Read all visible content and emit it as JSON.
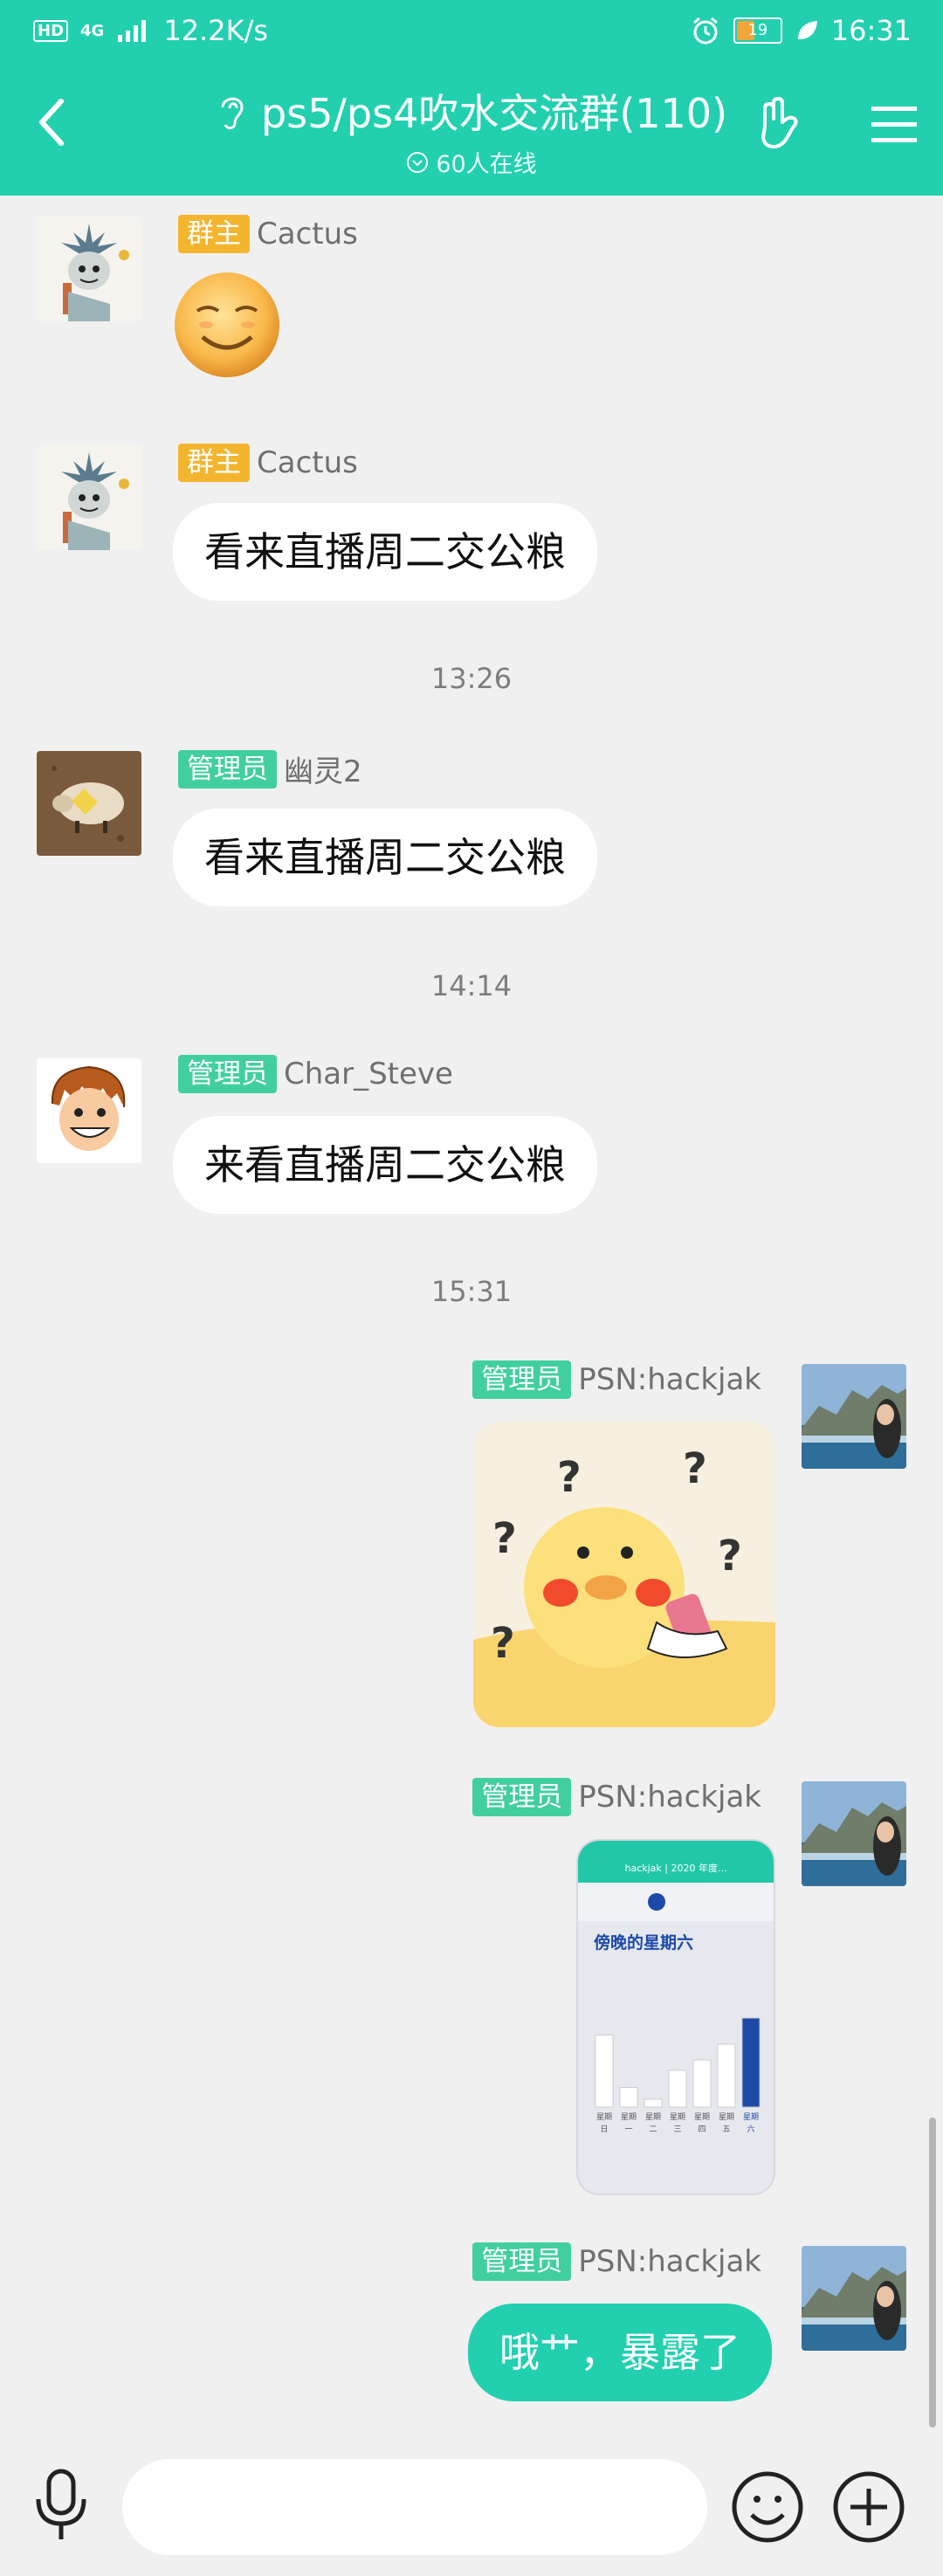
{
  "status_bar": {
    "network_type": "HD",
    "signal": "4G",
    "speed": "12.2K/s",
    "battery": "19",
    "time": "16:31"
  },
  "header": {
    "title": "ps5/ps4吹水交流群(110)",
    "online": "60人在线"
  },
  "messages": [
    {
      "role": "群主",
      "name": "Cactus"
    },
    {
      "role": "群主",
      "name": "Cactus",
      "text": "看来直播周二交公粮"
    },
    {
      "time": "13:26"
    },
    {
      "role": "管理员",
      "name": "幽灵2",
      "text": "看来直播周二交公粮"
    },
    {
      "time": "14:14"
    },
    {
      "role": "管理员",
      "name": "Char_Steve",
      "text": "来看直播周二交公粮"
    },
    {
      "time": "15:31"
    },
    {
      "role": "管理员",
      "name": "PSN:hackjak"
    },
    {
      "role": "管理员",
      "name": "PSN:hackjak"
    },
    {
      "role": "管理员",
      "name": "PSN:hackjak",
      "text": "哦艹，暴露了"
    }
  ],
  "screenshot_thumb": {
    "title": "hackjak | 2020 年度...",
    "heading": "傍晚的星期六",
    "days": [
      "星期日",
      "星期一",
      "星期二",
      "星期三",
      "星期四",
      "星期五",
      "星期六"
    ],
    "day_top": [
      "星期",
      "星期",
      "星期",
      "星期",
      "星期",
      "星期",
      "星期"
    ],
    "day_bottom": [
      "日",
      "一",
      "二",
      "三",
      "四",
      "五",
      "六"
    ],
    "values": [
      0.55,
      0.15,
      0.06,
      0.28,
      0.36,
      0.48,
      0.68
    ]
  },
  "colors": {
    "brand": "#22d0b0",
    "owner_badge": "#f4b52e",
    "admin_badge": "#42cf9e"
  }
}
